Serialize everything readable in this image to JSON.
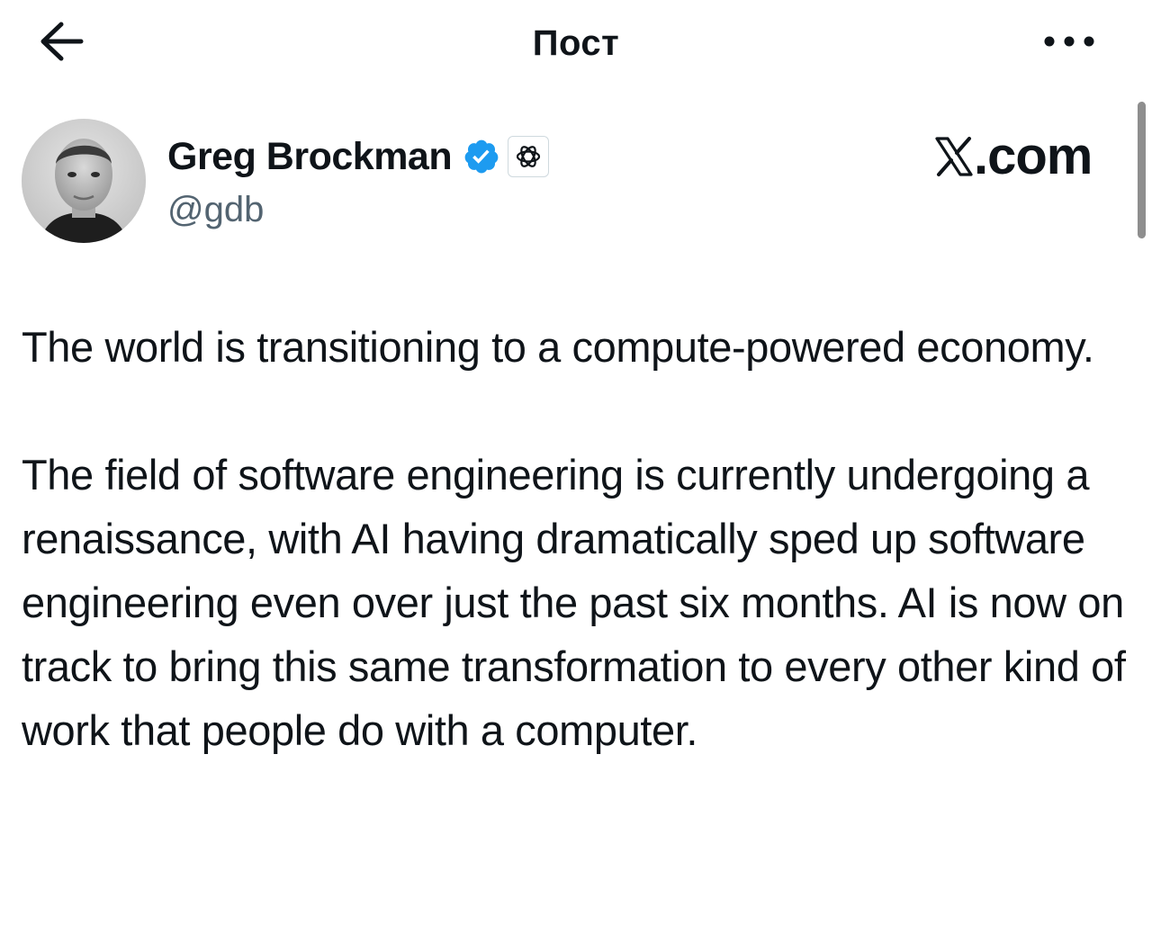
{
  "header": {
    "title": "Пост",
    "back_icon": "arrow-left-icon",
    "more_icon": "more-horizontal-icon"
  },
  "author": {
    "display_name": "Greg Brockman",
    "handle": "@gdb",
    "verified_icon": "verified-badge-icon",
    "affiliation_icon": "openai-logo-icon"
  },
  "watermark": {
    "text": ".com",
    "logo_icon": "x-logo-icon"
  },
  "post": {
    "paragraphs": [
      "The world is transitioning to a compute-powered economy.",
      "The field of software engineering is currently undergoing a renaissance, with AI having dramatically sped up software engineering even over just the past six months. AI is now on track to bring this same transformation to every other kind of work that people do with a computer."
    ]
  },
  "colors": {
    "text": "#0f1419",
    "secondary_text": "#536471",
    "verified_blue": "#1d9bf0",
    "background": "#ffffff"
  }
}
